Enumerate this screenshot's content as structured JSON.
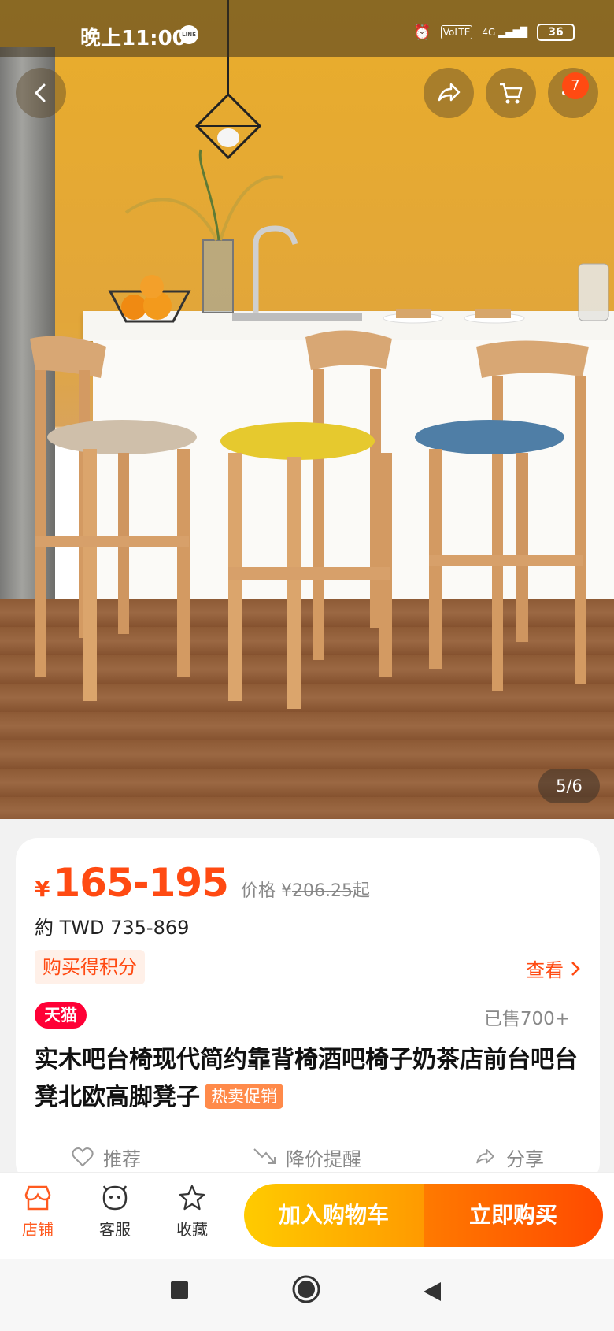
{
  "status_bar": {
    "time": "晚上11:00",
    "line_label": "LINE",
    "battery": "36",
    "network": "4G"
  },
  "header": {
    "cart_badge": "7"
  },
  "gallery": {
    "page_indicator": "5/6"
  },
  "product": {
    "currency_symbol": "¥",
    "price_range": "165-195",
    "original_price_label": "价格 ¥",
    "original_price": "206.25",
    "original_price_suffix": "起",
    "converted_price": "約 TWD 735-869",
    "points_tag": "购买得积分",
    "view_link": "查看",
    "store_badge": "天猫",
    "sold_count": "已售700+",
    "title": "实木吧台椅现代简约靠背椅酒吧椅子奶茶店前台吧台凳北欧高脚凳子",
    "hot_tag": "热卖促销"
  },
  "actions": {
    "recommend": "推荐",
    "price_alert": "降价提醒",
    "share": "分享"
  },
  "bottom_bar": {
    "store": "店铺",
    "service": "客服",
    "favorite": "收藏",
    "add_to_cart": "加入购物车",
    "buy_now": "立即购买"
  },
  "colors": {
    "accent": "#ff4a12",
    "tmall": "#ff0036",
    "cart_button": "#ffa800",
    "buy_button": "#ff5a00"
  }
}
